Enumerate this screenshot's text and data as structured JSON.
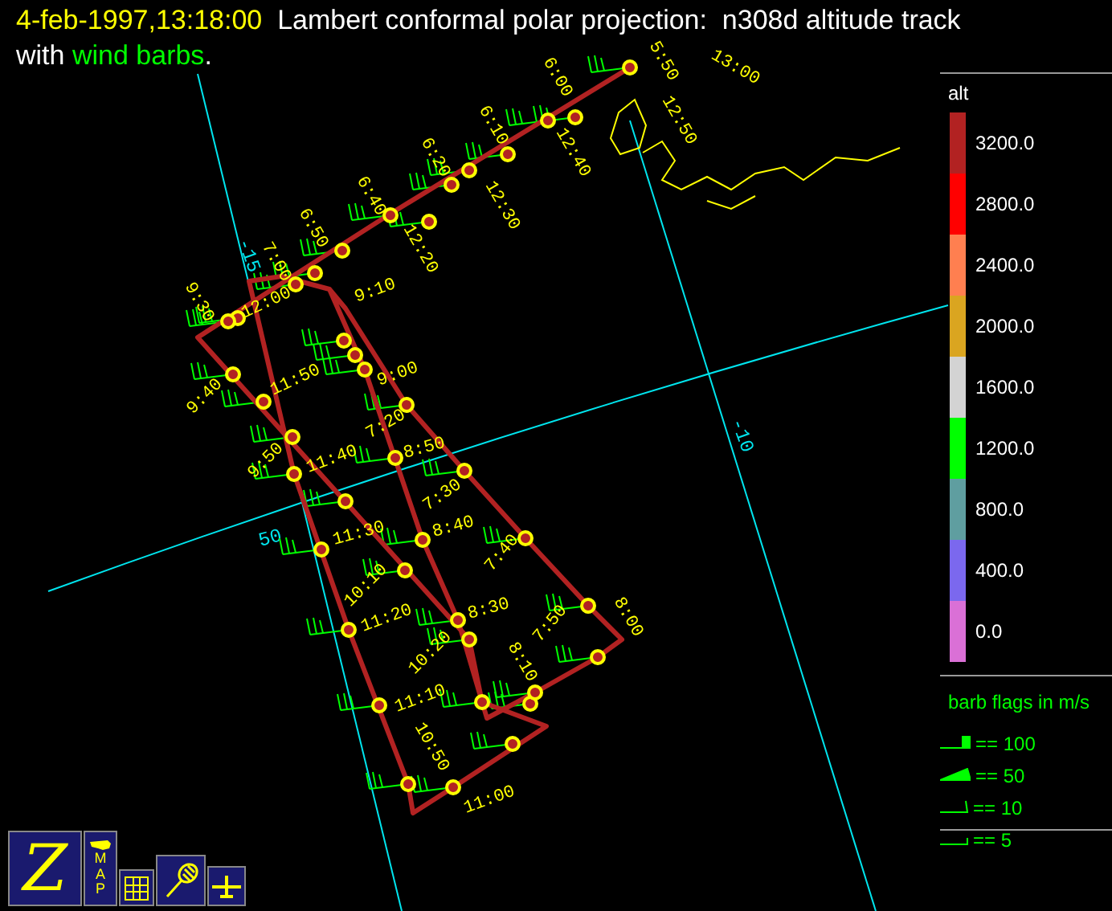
{
  "header": {
    "title_lines": [
      [
        {
          "text": "4-feb-1997,13:18:00",
          "color": "#ffff00"
        },
        {
          "text": "  Lambert conformal polar projection:  n308d altitude track",
          "color": "#ffffff"
        }
      ],
      [
        {
          "text": "with ",
          "color": "#ffffff"
        },
        {
          "text": "wind barbs",
          "color": "#00ff00"
        },
        {
          "text": ".",
          "color": "#ffffff"
        }
      ]
    ]
  },
  "map": {
    "graticule_labels": [
      "-15",
      "-10",
      "50"
    ],
    "track_times": [
      "13:00",
      "5:50",
      "12:50",
      "6:00",
      "12:40",
      "6:10",
      "12:30",
      "6:20",
      "6:40",
      "12:20",
      "6:50",
      "7:00",
      "9:30",
      "12:00",
      "9:10",
      "9:40",
      "11:50",
      "9:00",
      "7:20",
      "9:50",
      "11:40",
      "8:50",
      "7:30",
      "11:30",
      "8:40",
      "7:40",
      "10:10",
      "11:20",
      "8:30",
      "7:50",
      "8:00",
      "10:20",
      "11:10",
      "8:10",
      "10:50",
      "11:00"
    ]
  },
  "legend": {
    "title": "alt",
    "bins": [
      {
        "label": "3200.0",
        "color": "#b22222"
      },
      {
        "label": "2800.0",
        "color": "#ff0000"
      },
      {
        "label": "2400.0",
        "color": "#ff7f50"
      },
      {
        "label": "2000.0",
        "color": "#daa520"
      },
      {
        "label": "1600.0",
        "color": "#d3d3d3"
      },
      {
        "label": "1200.0",
        "color": "#00ff00"
      },
      {
        "label": "800.0",
        "color": "#5f9ea0"
      },
      {
        "label": "400.0",
        "color": "#7b68ee"
      },
      {
        "label": "0.0",
        "color": "#da70d6"
      }
    ]
  },
  "barb_legend": {
    "title": "barb flags in m/s",
    "items": [
      {
        "label": "== 100",
        "kind": "flag"
      },
      {
        "label": "== 50",
        "kind": "pennant"
      },
      {
        "label": "== 10",
        "kind": "full"
      },
      {
        "label": "== 5",
        "kind": "half"
      }
    ]
  },
  "toolbar": [
    {
      "kind": "logo",
      "label": "Z"
    },
    {
      "kind": "map",
      "label": "MAP"
    },
    {
      "kind": "grid"
    },
    {
      "kind": "racket"
    },
    {
      "kind": "plane"
    }
  ]
}
